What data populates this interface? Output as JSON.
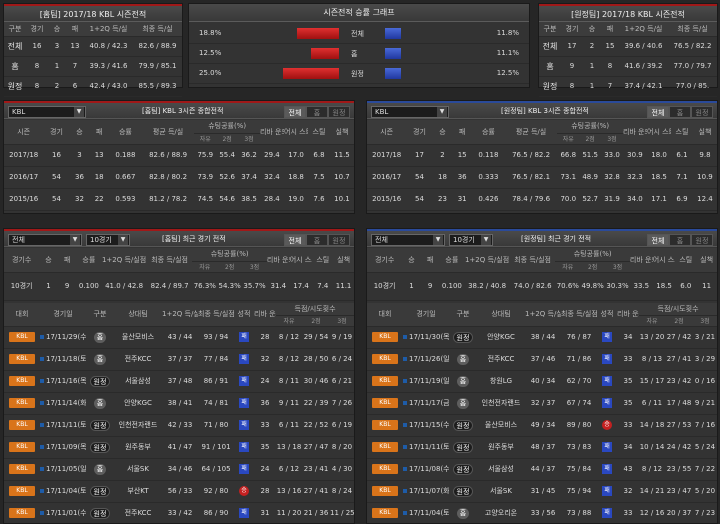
{
  "home_summary": {
    "title": "[홈팀] 2017/18 KBL 시즌전적",
    "headers": [
      "구분",
      "경기",
      "승",
      "패",
      "1+2Q 득/실",
      "최종 득/실"
    ],
    "rows": [
      [
        "전체",
        "16",
        "3",
        "13",
        "40.8 / 42.3",
        "82.6 / 88.9"
      ],
      [
        "홈",
        "8",
        "1",
        "7",
        "39.3 / 41.6",
        "79.9 / 85.1"
      ],
      [
        "원정",
        "8",
        "2",
        "6",
        "42.4 / 43.0",
        "85.5 / 89.3"
      ]
    ]
  },
  "graph": {
    "title": "시즌전적 승률 그래프",
    "rows": [
      {
        "label": "전체",
        "left": "18.8%",
        "right": "11.8%",
        "home_pct": 18.8,
        "away_pct": 11.8
      },
      {
        "label": "홈",
        "left": "12.5%",
        "right": "11.1%",
        "home_pct": 12.5,
        "away_pct": 11.1
      },
      {
        "label": "원정",
        "left": "25.0%",
        "right": "12.5%",
        "home_pct": 25.0,
        "away_pct": 12.5
      }
    ]
  },
  "away_summary": {
    "title": "[원정팀] 2017/18 KBL 시즌전적",
    "headers": [
      "구분",
      "경기",
      "승",
      "패",
      "1+2Q 득/실",
      "최종 득/실"
    ],
    "rows": [
      [
        "전체",
        "17",
        "2",
        "15",
        "39.6 / 40.6",
        "76.5 / 82.2"
      ],
      [
        "홈",
        "9",
        "1",
        "8",
        "41.6 / 39.2",
        "77.0 / 79.7"
      ],
      [
        "원정",
        "8",
        "1",
        "7",
        "37.4 / 42.1",
        "77.0 / 85."
      ]
    ]
  },
  "home_3season": {
    "select": "KBL",
    "title": "[홈팀] KBL 3시즌 종합전적",
    "tabs": [
      "전체",
      "홈",
      "원정"
    ],
    "headers": [
      "시즌",
      "경기",
      "승",
      "패",
      "승률",
      "평균 득/실",
      "슈팅공률(%)",
      "리바 운드",
      "어시 스트",
      "스틸",
      "실책"
    ],
    "subheaders": [
      "자유",
      "2점",
      "3점"
    ],
    "rows": [
      [
        "2017/18",
        "16",
        "3",
        "13",
        "0.188",
        "82.6 / 88.9",
        "75.9",
        "55.4",
        "36.2",
        "29.4",
        "17.0",
        "6.8",
        "11.5"
      ],
      [
        "2016/17",
        "54",
        "36",
        "18",
        "0.667",
        "82.8 / 80.2",
        "73.9",
        "52.6",
        "37.4",
        "32.4",
        "18.8",
        "7.5",
        "10.7"
      ],
      [
        "2015/16",
        "54",
        "32",
        "22",
        "0.593",
        "81.2 / 78.2",
        "74.5",
        "54.6",
        "38.5",
        "28.4",
        "19.0",
        "7.6",
        "10.1"
      ]
    ]
  },
  "away_3season": {
    "select": "KBL",
    "title": "[원정팀] KBL 3시즌 종합전적",
    "tabs": [
      "전체",
      "홈",
      "원정"
    ],
    "headers": [
      "시즌",
      "경기",
      "승",
      "패",
      "승률",
      "평균 득/실",
      "슈팅공률(%)",
      "리바 운드",
      "어시 스트",
      "스틸",
      "실책"
    ],
    "subheaders": [
      "자유",
      "2점",
      "3점"
    ],
    "rows": [
      [
        "2017/18",
        "17",
        "2",
        "15",
        "0.118",
        "76.5 / 82.2",
        "66.8",
        "51.5",
        "33.0",
        "30.9",
        "18.0",
        "6.1",
        "9.8"
      ],
      [
        "2016/17",
        "54",
        "18",
        "36",
        "0.333",
        "76.5 / 82.1",
        "73.1",
        "48.9",
        "32.8",
        "32.3",
        "18.5",
        "7.1",
        "10.9"
      ],
      [
        "2015/16",
        "54",
        "23",
        "31",
        "0.426",
        "78.4 / 79.6",
        "70.0",
        "52.7",
        "31.9",
        "34.0",
        "17.1",
        "6.9",
        "12.4"
      ]
    ]
  },
  "home_recent": {
    "select1": "전체",
    "select2": "10경기",
    "title": "[홈팀] 최근 경기 전적",
    "tabs": [
      "전체",
      "홈",
      "원정"
    ],
    "summary_headers": [
      "경기수",
      "승",
      "패",
      "승률",
      "1+2Q 득/실점",
      "최종 득/실점",
      "슈팅공률(%)",
      "리바 운드",
      "어시 스트",
      "스틸",
      "실책"
    ],
    "summary_sub": [
      "자유",
      "2점",
      "3점"
    ],
    "summary": [
      "10경기",
      "1",
      "9",
      "0.100",
      "41.0 / 42.8",
      "82.4 / 89.7",
      "76.3%",
      "54.3%",
      "35.7%",
      "31.4",
      "17.4",
      "7.4",
      "11.1"
    ],
    "game_headers": [
      "대회",
      "경기일",
      "구분",
      "상대팀",
      "1+2Q 득/실점",
      "최종 득/실점",
      "성적",
      "리바 운드",
      "득점/시도횟수"
    ],
    "game_sub": [
      "자유",
      "2점",
      "3점"
    ],
    "games": [
      [
        "KBL",
        "17/11/29(수)",
        "홈",
        "울산모비스",
        "43 / 44",
        "93 / 94",
        "패",
        "28",
        "8 / 12",
        "29 / 54",
        "9 / 19"
      ],
      [
        "KBL",
        "17/11/18(토)",
        "홈",
        "전주KCC",
        "37 / 37",
        "77 / 84",
        "패",
        "32",
        "8 / 12",
        "28 / 50",
        "6 / 24"
      ],
      [
        "KBL",
        "17/11/16(목)",
        "원정",
        "서울삼성",
        "37 / 48",
        "86 / 91",
        "패",
        "24",
        "8 / 11",
        "30 / 46",
        "6 / 21"
      ],
      [
        "KBL",
        "17/11/14(화)",
        "홈",
        "안양KGC",
        "38 / 41",
        "74 / 81",
        "패",
        "36",
        "9 / 11",
        "22 / 39",
        "7 / 26"
      ],
      [
        "KBL",
        "17/11/11(토)",
        "원정",
        "인천전자랜드",
        "42 / 33",
        "71 / 80",
        "패",
        "33",
        "6 / 11",
        "22 / 52",
        "6 / 19"
      ],
      [
        "KBL",
        "17/11/09(목)",
        "원정",
        "원주동부",
        "41 / 47",
        "91 / 101",
        "패",
        "35",
        "13 / 18",
        "27 / 47",
        "8 / 20"
      ],
      [
        "KBL",
        "17/11/05(일)",
        "홈",
        "서울SK",
        "34 / 46",
        "64 / 105",
        "패",
        "24",
        "6 / 12",
        "23 / 41",
        "4 / 30"
      ],
      [
        "KBL",
        "17/11/04(토)",
        "원정",
        "부산KT",
        "56 / 33",
        "92 / 80",
        "승",
        "28",
        "13 / 16",
        "27 / 41",
        "8 / 24"
      ],
      [
        "KBL",
        "17/11/01(수)",
        "원정",
        "전주KCC",
        "33 / 42",
        "86 / 90",
        "패",
        "31",
        "11 / 20",
        "21 / 36",
        "11 / 25"
      ],
      [
        "KBL",
        "17/10/28(토)",
        "홈",
        "안양KGC",
        "43 / 46",
        "90 / 91",
        "패",
        "33",
        "6 / 14",
        "29 / 55",
        "9 / 22"
      ]
    ]
  },
  "away_recent": {
    "select1": "전체",
    "select2": "10경기",
    "title": "[원정팀] 최근 경기 전적",
    "tabs": [
      "전체",
      "홈",
      "원정"
    ],
    "summary_headers": [
      "경기수",
      "승",
      "패",
      "승률",
      "1+2Q 득/실점",
      "최종 득/실점",
      "슈팅공률(%)",
      "리바 운드",
      "어시 스트",
      "스틸",
      "실책"
    ],
    "summary_sub": [
      "자유",
      "2점",
      "3점"
    ],
    "summary": [
      "10경기",
      "1",
      "9",
      "0.100",
      "38.2 / 40.8",
      "74.0 / 82.6",
      "70.6%",
      "49.8%",
      "30.3%",
      "33.5",
      "18.5",
      "6.0",
      "11"
    ],
    "game_headers": [
      "대회",
      "경기일",
      "구분",
      "상대팀",
      "1+2Q 득/실점",
      "최종 득/실점",
      "성적",
      "리바 운드",
      "득점/시도횟수"
    ],
    "game_sub": [
      "자유",
      "2점",
      "3점"
    ],
    "games": [
      [
        "KBL",
        "17/11/30(목)",
        "원정",
        "안양KGC",
        "38 / 44",
        "76 / 87",
        "패",
        "34",
        "13 / 20",
        "27 / 42",
        "3 / 21"
      ],
      [
        "KBL",
        "17/11/26(일)",
        "홈",
        "전주KCC",
        "37 / 46",
        "71 / 86",
        "패",
        "33",
        "8 / 13",
        "27 / 41",
        "3 / 29"
      ],
      [
        "KBL",
        "17/11/19(일)",
        "홈",
        "창원LG",
        "40 / 34",
        "62 / 70",
        "패",
        "35",
        "15 / 17",
        "23 / 42",
        "0 / 16"
      ],
      [
        "KBL",
        "17/11/17(금)",
        "홈",
        "인천전자랜드",
        "32 / 37",
        "67 / 74",
        "패",
        "35",
        "6 / 11",
        "17 / 48",
        "9 / 21"
      ],
      [
        "KBL",
        "17/11/15(수)",
        "원정",
        "울산모비스",
        "49 / 34",
        "89 / 80",
        "승",
        "33",
        "14 / 18",
        "27 / 53",
        "7 / 16"
      ],
      [
        "KBL",
        "17/11/11(토)",
        "원정",
        "원주동부",
        "48 / 37",
        "73 / 83",
        "패",
        "34",
        "10 / 14",
        "24 / 42",
        "5 / 24"
      ],
      [
        "KBL",
        "17/11/08(수)",
        "원정",
        "서울삼성",
        "44 / 37",
        "75 / 84",
        "패",
        "43",
        "8 / 12",
        "23 / 55",
        "7 / 22"
      ],
      [
        "KBL",
        "17/11/07(화)",
        "원정",
        "서울SK",
        "31 / 45",
        "75 / 94",
        "패",
        "32",
        "14 / 21",
        "23 / 47",
        "5 / 20"
      ],
      [
        "KBL",
        "17/11/04(토)",
        "홈",
        "고양오리온",
        "33 / 56",
        "73 / 88",
        "패",
        "33",
        "12 / 16",
        "20 / 37",
        "7 / 23"
      ],
      [
        "KBL",
        "17/11/02(목)",
        "원정",
        "안양KGC",
        "38 / 43",
        "79 / 94",
        "패",
        "35",
        "9 / 14",
        "26 / 46",
        "6 / 17"
      ]
    ]
  }
}
